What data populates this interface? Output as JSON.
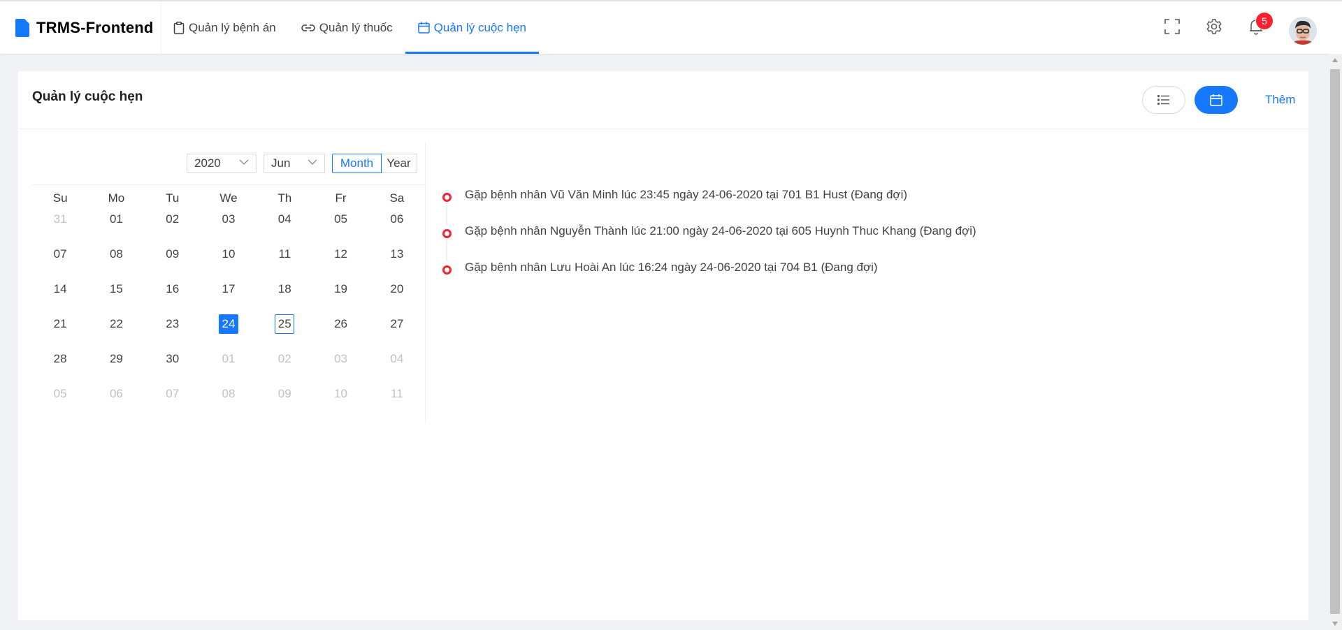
{
  "app": {
    "title": "TRMS-Frontend"
  },
  "nav": {
    "items": [
      {
        "label": "Quản lý bệnh án",
        "icon": "clipboard-icon"
      },
      {
        "label": "Quản lý thuốc",
        "icon": "link-icon"
      },
      {
        "label": "Quản lý cuộc hẹn",
        "icon": "calendar-icon",
        "active": true
      }
    ]
  },
  "header_actions": {
    "fullscreen_icon": "fullscreen-icon",
    "settings_icon": "gear-icon",
    "notification_icon": "bell-icon",
    "notification_count": "5"
  },
  "page": {
    "title": "Quản lý cuộc hẹn",
    "view_list_icon": "list-icon",
    "view_calendar_icon": "calendar-icon",
    "add_label": "Thêm"
  },
  "calendar": {
    "year": "2020",
    "month": "Jun",
    "mode_month": "Month",
    "mode_year": "Year",
    "weekdays": [
      "Su",
      "Mo",
      "Tu",
      "We",
      "Th",
      "Fr",
      "Sa"
    ],
    "weeks": [
      [
        "31",
        "01",
        "02",
        "03",
        "04",
        "05",
        "06"
      ],
      [
        "07",
        "08",
        "09",
        "10",
        "11",
        "12",
        "13"
      ],
      [
        "14",
        "15",
        "16",
        "17",
        "18",
        "19",
        "20"
      ],
      [
        "21",
        "22",
        "23",
        "24",
        "25",
        "26",
        "27"
      ],
      [
        "28",
        "29",
        "30",
        "01",
        "02",
        "03",
        "04"
      ],
      [
        "05",
        "06",
        "07",
        "08",
        "09",
        "10",
        "11"
      ]
    ],
    "selected_date": "24",
    "today_date": "25"
  },
  "appointments": [
    "Gặp bệnh nhân Vũ Văn Minh lúc 23:45 ngày 24-06-2020 tại 701 B1 Hust (Đang đợi)",
    "Gặp bệnh nhân Nguyễn Thành lúc 21:00 ngày 24-06-2020 tại 605 Huynh Thuc Khang (Đang đợi)",
    "Gặp bệnh nhân Lưu Hoài An lúc 16:24 ngày 24-06-2020 tại 704 B1 (Đang đợi)"
  ],
  "colors": {
    "accent": "#1677ff",
    "danger": "#f5222d"
  }
}
